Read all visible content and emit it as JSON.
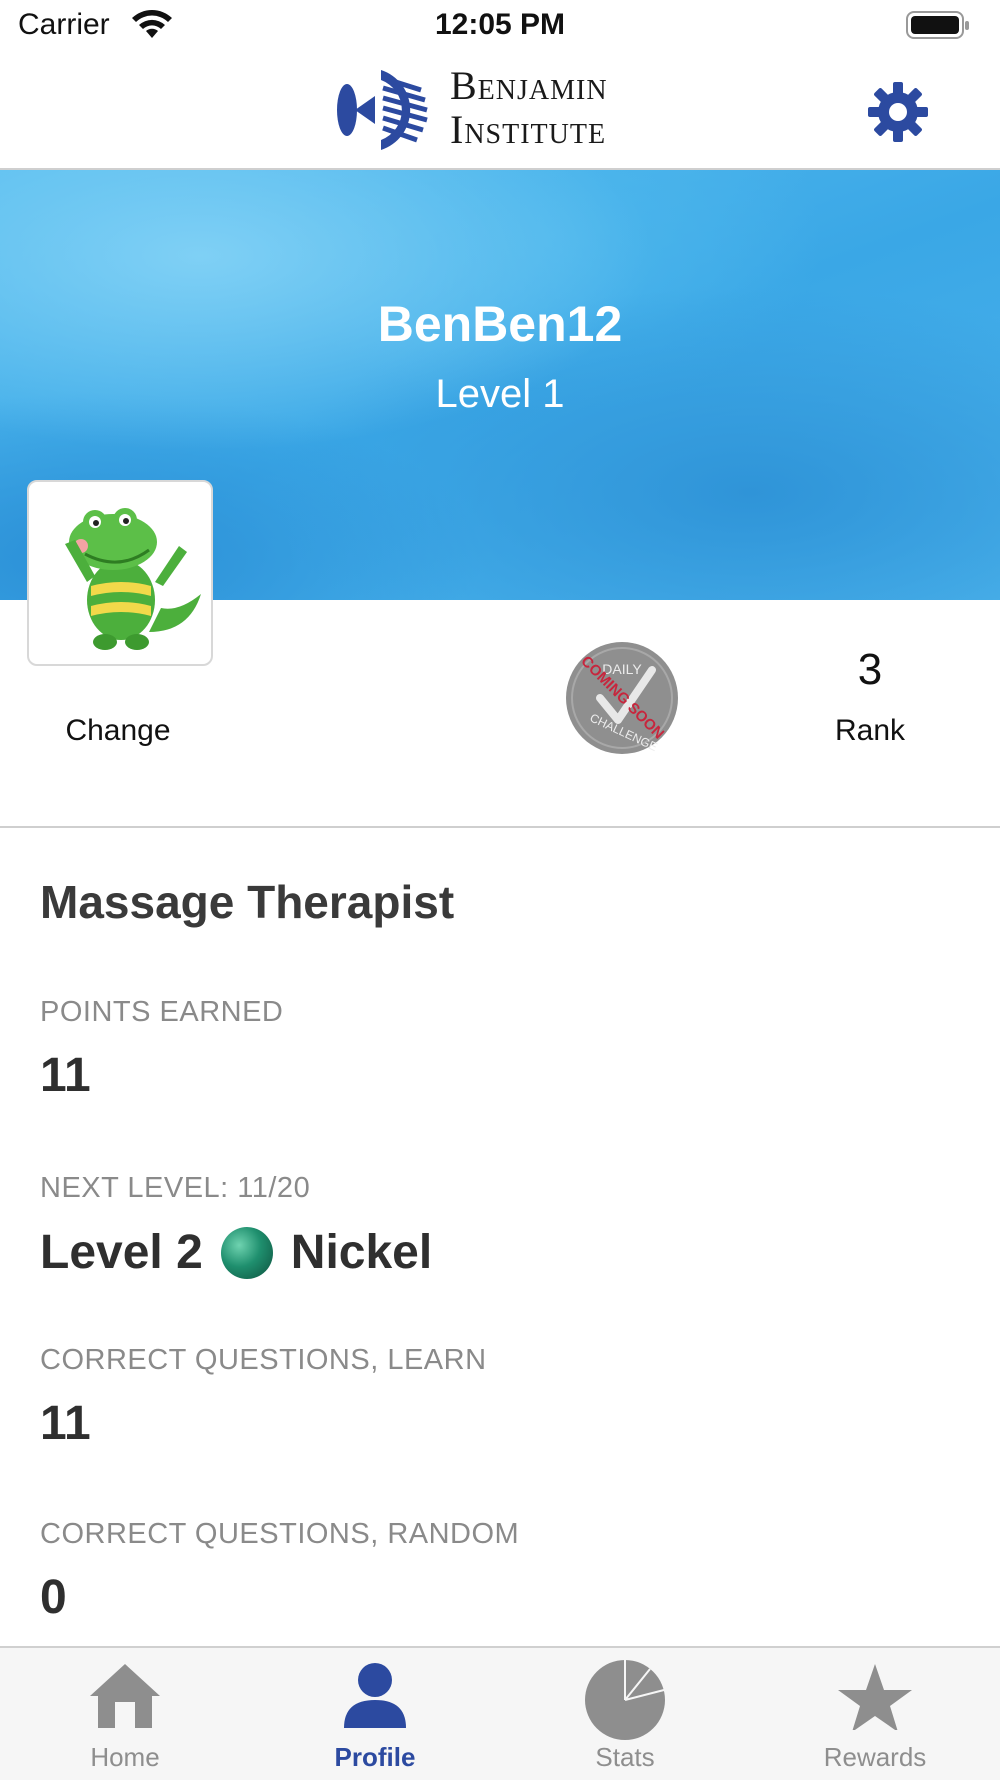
{
  "status_bar": {
    "carrier": "Carrier",
    "time": "12:05 PM"
  },
  "header": {
    "logo_line1": "Benjamin",
    "logo_line2": "Institute",
    "settings_icon": "gear-icon",
    "accent_color": "#2c4aa0"
  },
  "profile": {
    "username": "BenBen12",
    "level": "Level 1",
    "avatar_icon": "crocodile-avatar-icon",
    "change_label": "Change",
    "daily_challenge_icon": "daily-challenge-coming-soon-icon",
    "daily_challenge_text": "DAILY",
    "daily_challenge_text2": "CHALLENGE",
    "daily_challenge_stamp": "COMING SOON",
    "rank_value": "3",
    "rank_label": "Rank"
  },
  "stats": {
    "title": "Massage Therapist",
    "points_label": "POINTS EARNED",
    "points_value": "11",
    "next_level_label": "NEXT LEVEL: 11/20",
    "next_level_prefix": "Level 2",
    "next_level_name": "Nickel",
    "learn_label": "CORRECT QUESTIONS, LEARN",
    "learn_value": "11",
    "random_label": "CORRECT QUESTIONS, RANDOM",
    "random_value": "0"
  },
  "tabs": [
    {
      "label": "Home",
      "icon": "home-icon"
    },
    {
      "label": "Profile",
      "icon": "profile-icon"
    },
    {
      "label": "Stats",
      "icon": "stats-pie-icon"
    },
    {
      "label": "Rewards",
      "icon": "star-icon"
    }
  ],
  "active_tab": "Profile"
}
